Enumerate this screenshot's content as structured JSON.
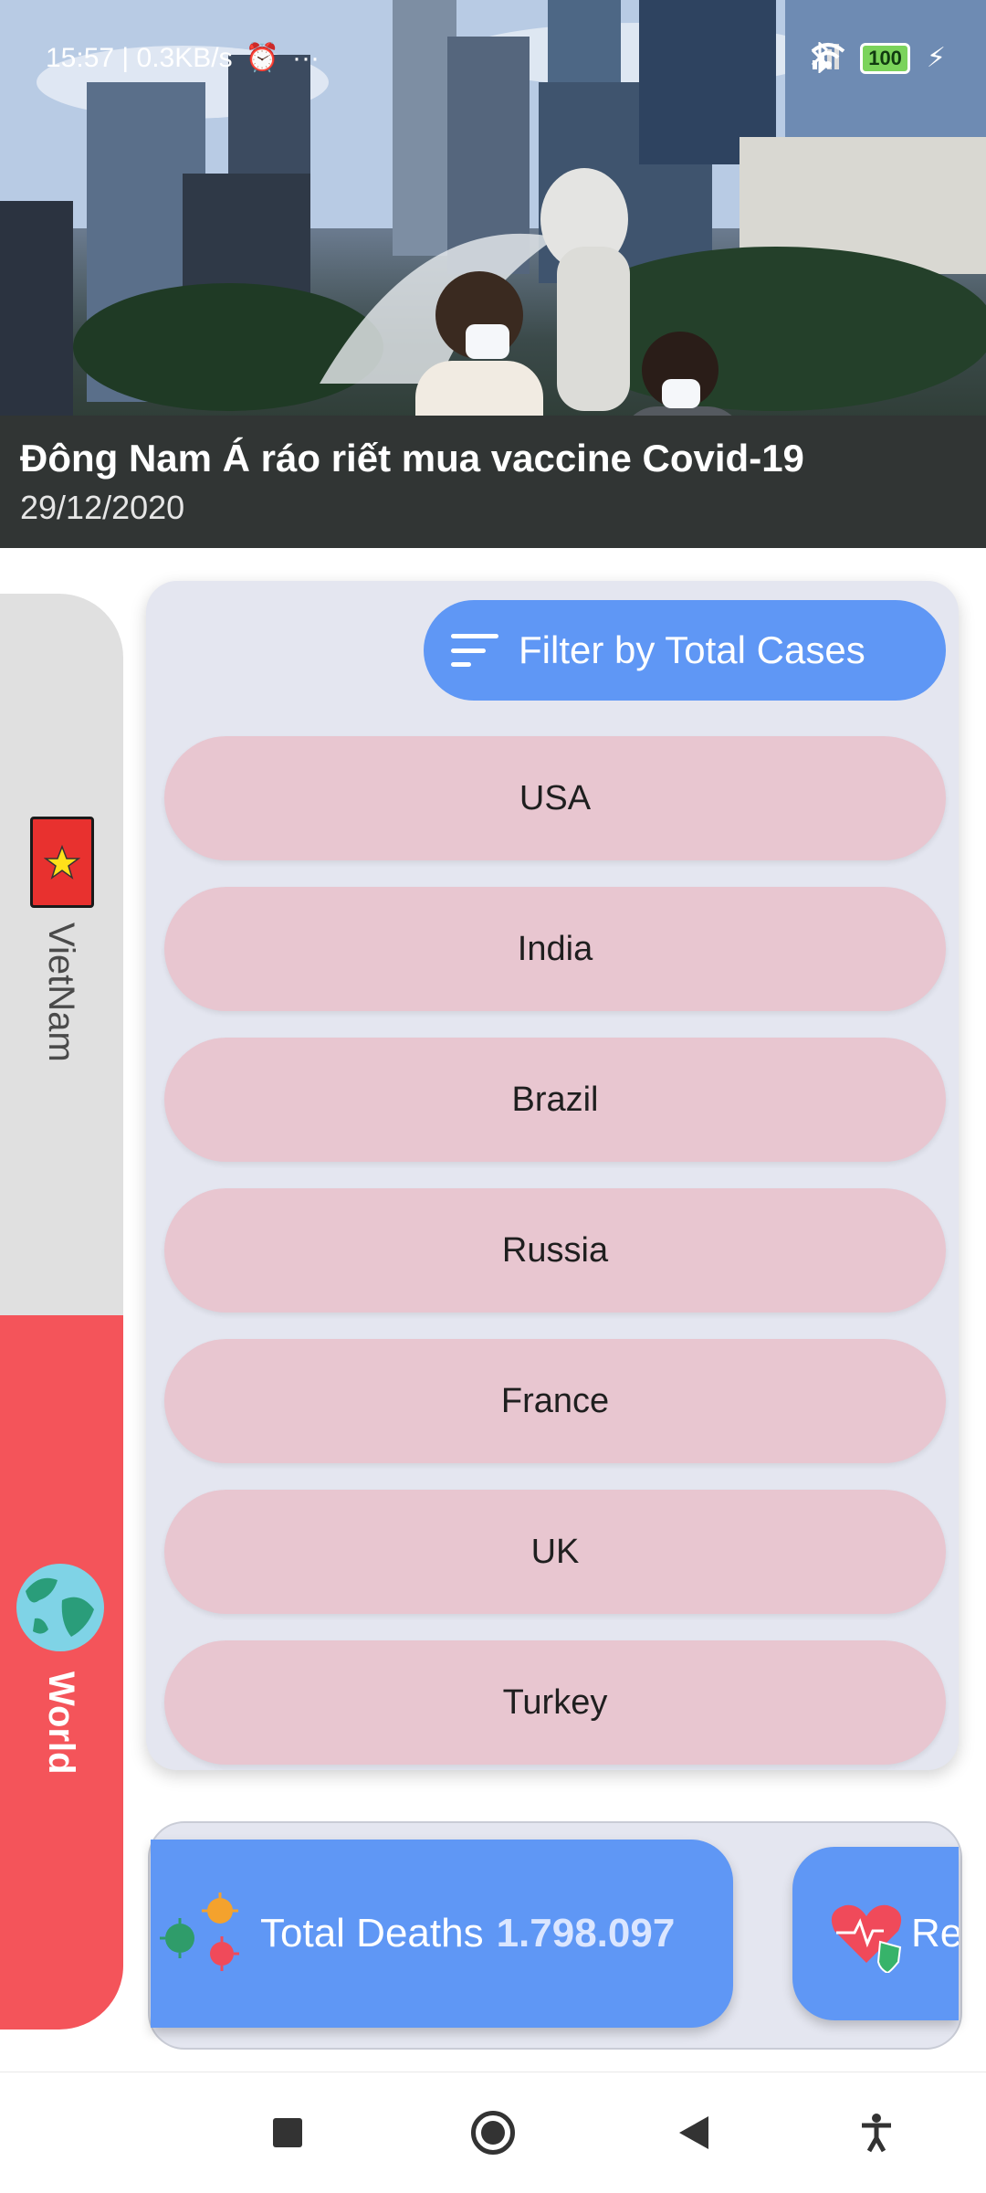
{
  "status_bar": {
    "time_and_speed": "15:57 | 0.3KB/s",
    "battery": "100",
    "icons": [
      "alarm-icon",
      "bluetooth-icon",
      "signal-icon",
      "wifi-icon",
      "battery-icon",
      "charging-icon"
    ]
  },
  "news": {
    "title": "Đông Nam Á ráo riết mua vaccine Covid-19",
    "date": "29/12/2020"
  },
  "tabs": {
    "vietnam": "VietNam",
    "world": "World"
  },
  "filter": {
    "label": "Filter by Total Cases"
  },
  "countries": [
    "USA",
    "India",
    "Brazil",
    "Russia",
    "France",
    "UK",
    "Turkey"
  ],
  "stats": {
    "deaths_label": "Total Deaths",
    "deaths_value": "1.798.097",
    "recovered_label_visible": "Re"
  },
  "colors": {
    "accent_blue": "#5f97f5",
    "country_pill": "#e8c6d0",
    "world_tab": "#f4545a",
    "vietnam_tab": "#e0e0e0"
  },
  "navbar": {
    "icons": [
      "recents-square-icon",
      "home-circle-icon",
      "back-triangle-icon",
      "accessibility-icon"
    ]
  }
}
